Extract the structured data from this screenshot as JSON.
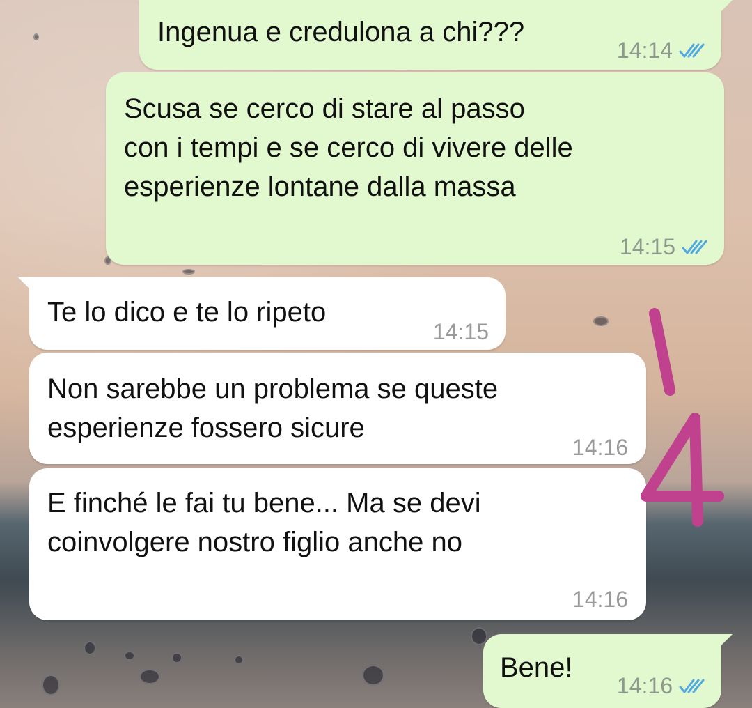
{
  "messages": [
    {
      "text": "Ingenua e credulona a chi???",
      "time": "14:14",
      "direction": "out",
      "status": "read-double-check-icon"
    },
    {
      "text": "Scusa se cerco di stare al passo\ncon i tempi e se cerco di vivere delle\nesperienze lontane dalla massa",
      "time": "14:15",
      "direction": "out",
      "status": "read-double-check-icon"
    },
    {
      "text": "Te lo dico e te lo ripeto",
      "time": "14:15",
      "direction": "in"
    },
    {
      "text": "Non sarebbe un problema se queste\nesperienze fossero sicure",
      "time": "14:16",
      "direction": "in"
    },
    {
      "text": "E finché le fai tu bene... Ma se devi\ncoinvolgere nostro figlio anche no",
      "time": "14:16",
      "direction": "in"
    },
    {
      "text": "Bene!",
      "time": "14:16",
      "direction": "out",
      "status": "read-double-check-icon"
    }
  ],
  "annotation": {
    "text": "4",
    "color": "#c0418e"
  },
  "colors": {
    "outgoing_bubble": "#e2f9cf",
    "incoming_bubble": "#ffffff",
    "read_tick": "#4fa8e0"
  }
}
